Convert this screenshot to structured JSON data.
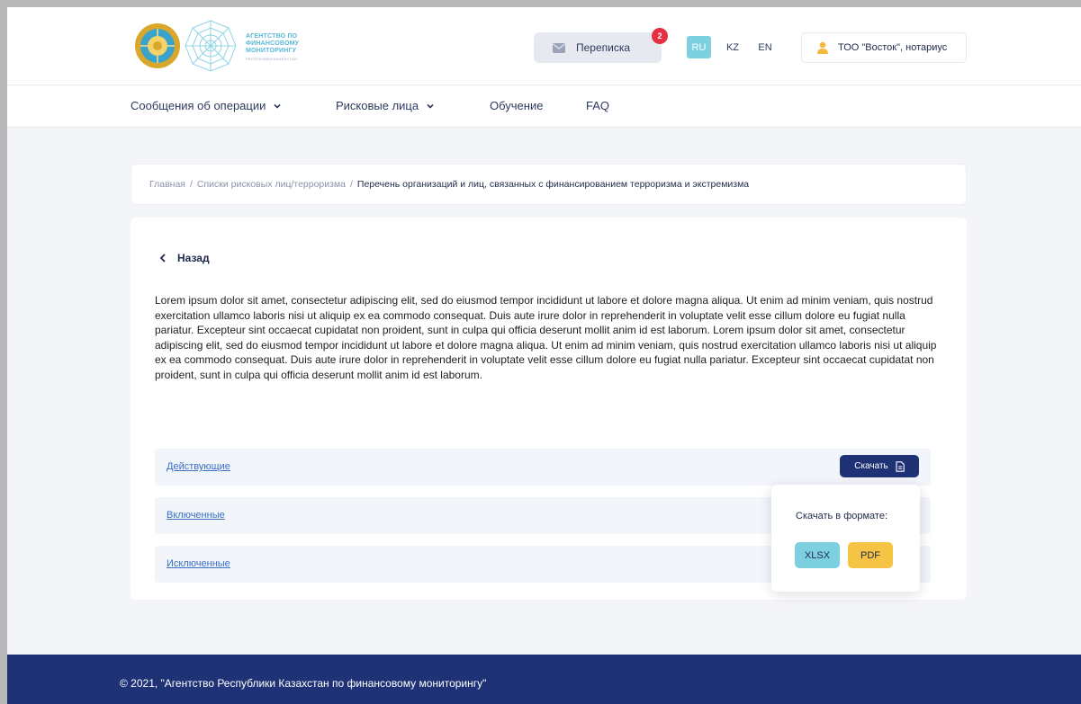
{
  "header": {
    "agency_name": "АГЕНТСТВО ПО ФИНАНСОВОМУ МОНИТОРИНГУ",
    "agency_sub": "РЕСПУБЛИКИ КАЗАХСТАН",
    "messages_label": "Переписка",
    "messages_badge": "2",
    "languages": [
      "RU",
      "KZ",
      "EN"
    ],
    "active_language": "RU",
    "user_label": "ТОО \"Восток\", нотариус"
  },
  "nav": {
    "items": [
      {
        "label": "Сообщения об операции",
        "dropdown": true
      },
      {
        "label": "Рисковые лица",
        "dropdown": true
      },
      {
        "label": "Обучение",
        "dropdown": false
      },
      {
        "label": "FAQ",
        "dropdown": false
      }
    ]
  },
  "breadcrumb": {
    "items": [
      "Главная",
      "Списки рисковых лиц/терроризма",
      "Перечень организаций и лиц, связанных с финансированием терроризма и экстремизма"
    ],
    "separator": "/"
  },
  "content": {
    "back_label": "Назад",
    "description": "Lorem ipsum dolor sit amet, consectetur adipiscing elit, sed do eiusmod tempor incididunt ut labore et dolore magna aliqua. Ut enim ad minim veniam, quis nostrud exercitation ullamco laboris nisi ut aliquip ex ea commodo consequat. Duis aute irure dolor in reprehenderit in voluptate velit esse cillum dolore eu fugiat nulla pariatur. Excepteur sint occaecat cupidatat non proident, sunt in culpa qui officia deserunt mollit anim id est laborum. Lorem ipsum dolor sit amet, consectetur adipiscing elit, sed do eiusmod tempor incididunt ut labore et dolore magna aliqua. Ut enim ad minim veniam, quis nostrud exercitation ullamco laboris nisi ut aliquip ex ea commodo consequat. Duis aute irure dolor in reprehenderit in voluptate velit esse cillum dolore eu fugiat nulla pariatur. Excepteur sint occaecat cupidatat non proident, sunt in culpa qui officia deserunt mollit anim id est laborum.",
    "lists": [
      "Действующие",
      "Включенные",
      "Исключенные"
    ],
    "download_label": "Скачать",
    "popup": {
      "title": "Скачать в формате:",
      "formats": [
        "XLSX",
        "PDF"
      ]
    }
  },
  "footer": {
    "text": "© 2021, \"Агентство Республики Казахстан по финансовому мониторингу\""
  },
  "colors": {
    "primary": "#1e3275",
    "accent_cyan": "#7dd0e0",
    "accent_yellow": "#f6c445",
    "badge_red": "#e53042",
    "link": "#3a6fc4"
  }
}
